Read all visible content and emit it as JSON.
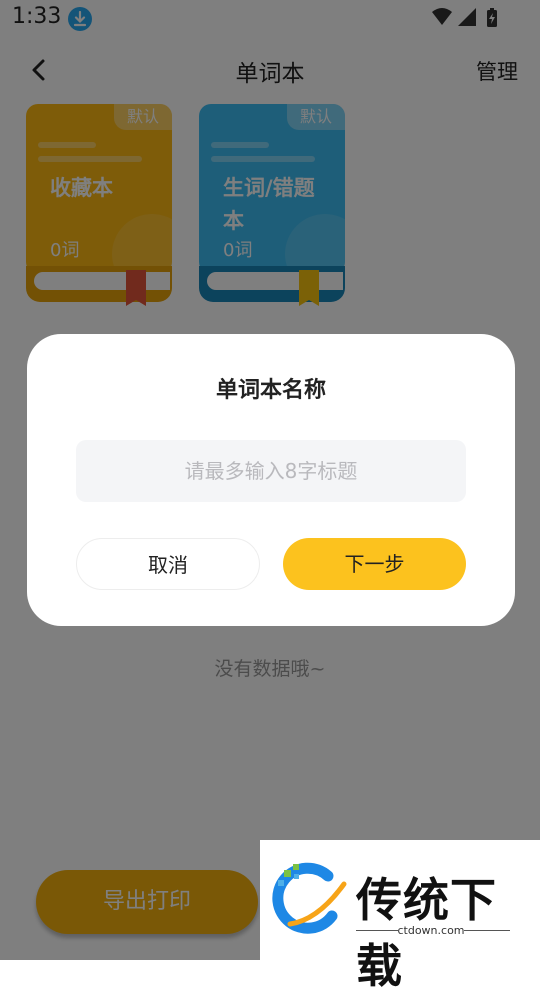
{
  "status_bar": {
    "time": "1:33",
    "icons": [
      "download-icon",
      "wifi-icon",
      "signal-icon",
      "battery-icon"
    ]
  },
  "header": {
    "title": "单词本",
    "manage_label": "管理"
  },
  "books": [
    {
      "tag": "默认",
      "name": "收藏本",
      "count": "0词",
      "color": "#e6a20b"
    },
    {
      "tag": "默认",
      "name": "生词/错题本",
      "count": "0词",
      "color": "#1886b8"
    }
  ],
  "empty_text": "没有数据哦~",
  "export_label": "导出打印",
  "dialog": {
    "title": "单词本名称",
    "input_placeholder": "请最多输入8字标题",
    "input_value": "",
    "cancel_label": "取消",
    "next_label": "下一步"
  },
  "watermark": {
    "brand": "传统下载",
    "url": "ctdown.com"
  },
  "colors": {
    "accent": "#fcc21e",
    "overlay": "rgba(0,0,0,0.5)"
  }
}
